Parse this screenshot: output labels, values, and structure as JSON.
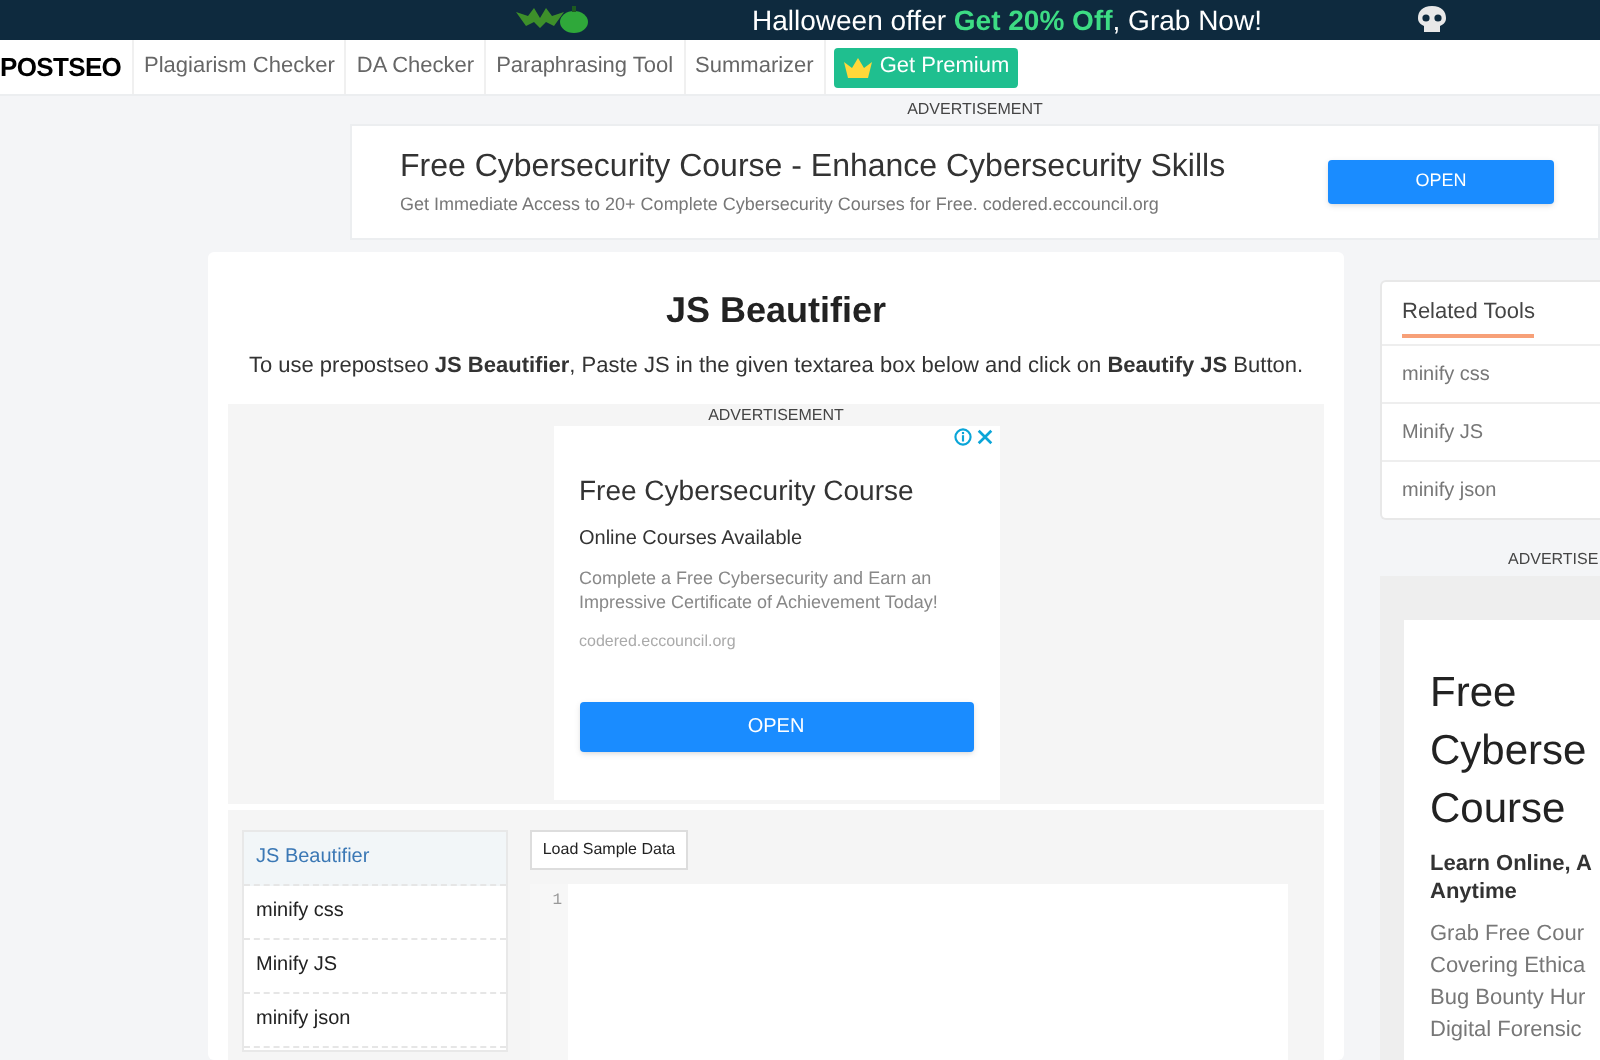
{
  "promo_banner": {
    "text_before": "Halloween offer ",
    "highlight": "Get 20% Off",
    "text_after": ", Grab Now!"
  },
  "nav": {
    "logo": "POSTSEO",
    "items": [
      {
        "label": "Plagiarism Checker",
        "kind": "link"
      },
      {
        "label": "DA Checker",
        "kind": "link"
      },
      {
        "label": "Paraphrasing Tool",
        "kind": "link"
      },
      {
        "label": "Summarizer",
        "kind": "link"
      },
      {
        "label": "Get Premium",
        "kind": "premium"
      }
    ]
  },
  "top_ad": {
    "label": "ADVERTISEMENT",
    "title": "Free Cybersecurity Course - Enhance Cybersecurity Skills",
    "subtitle": "Get Immediate Access to 20+ Complete Cybersecurity Courses for Free. codered.eccouncil.org",
    "button": "OPEN"
  },
  "main": {
    "title": "JS Beautifier",
    "description": "To use prepostseo **JS Beautifier**, Paste JS in the given textarea box below and click on **Beautify JS** Button.",
    "ad": {
      "label": "ADVERTISEMENT",
      "title": "Free Cybersecurity Course",
      "subtitle": "Online Courses Available",
      "body": "Complete a Free Cybersecurity and Earn an Impressive Certificate of Achievement Today!",
      "url": "codered.eccouncil.org",
      "button": "OPEN"
    },
    "tools": [
      {
        "label": "JS Beautifier",
        "selected": true
      },
      {
        "label": "minify css",
        "selected": false
      },
      {
        "label": "Minify JS",
        "selected": false
      },
      {
        "label": "minify json",
        "selected": false
      }
    ],
    "load_button": "Load Sample Data",
    "editor": {
      "line_numbers": [
        "1"
      ]
    }
  },
  "sidebar": {
    "heading": "Related Tools",
    "items": [
      "minify css",
      "Minify JS",
      "minify json"
    ],
    "ad": {
      "label": "ADVERTISE",
      "title_lines": [
        "Free",
        "Cyberse",
        "Course"
      ],
      "subtitle_lines": [
        "Learn Online, A",
        "Anytime"
      ],
      "body_lines": [
        "Grab Free Cour",
        "Covering Ethica",
        "Bug Bounty Hur",
        "Digital Forensic"
      ]
    }
  }
}
